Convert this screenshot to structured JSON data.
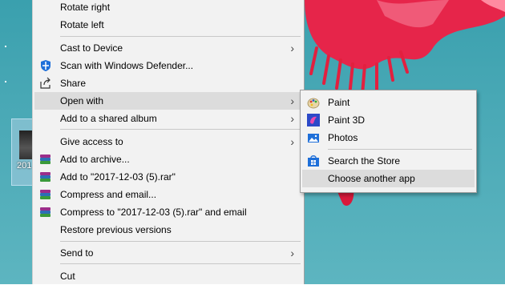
{
  "desktop": {
    "icon_label": "201"
  },
  "context_menu": {
    "items": [
      {
        "label": "Rotate right"
      },
      {
        "label": "Rotate left"
      },
      {
        "label": "Cast to Device"
      },
      {
        "label": "Scan with Windows Defender..."
      },
      {
        "label": "Share"
      },
      {
        "label": "Open with"
      },
      {
        "label": "Add to a shared album"
      },
      {
        "label": "Give access to"
      },
      {
        "label": "Add to archive..."
      },
      {
        "label": "Add to \"2017-12-03 (5).rar\""
      },
      {
        "label": "Compress and email..."
      },
      {
        "label": "Compress to \"2017-12-03 (5).rar\" and email"
      },
      {
        "label": "Restore previous versions"
      },
      {
        "label": "Send to"
      },
      {
        "label": "Cut"
      }
    ],
    "arrow_glyph": "›"
  },
  "open_with_submenu": {
    "items": [
      {
        "label": "Paint",
        "icon": "paint-icon"
      },
      {
        "label": "Paint 3D",
        "icon": "paint-3d-icon"
      },
      {
        "label": "Photos",
        "icon": "photos-icon"
      },
      {
        "label": "Search the Store",
        "icon": "store-icon"
      },
      {
        "label": "Choose another app",
        "icon": ""
      }
    ]
  },
  "colors": {
    "menu_bg": "#f2f2f2",
    "highlight": "#dcdcdc",
    "defender_blue": "#1e6fd9",
    "flower_red": "#e6254a",
    "desktop_teal": "#4aa9b6"
  }
}
